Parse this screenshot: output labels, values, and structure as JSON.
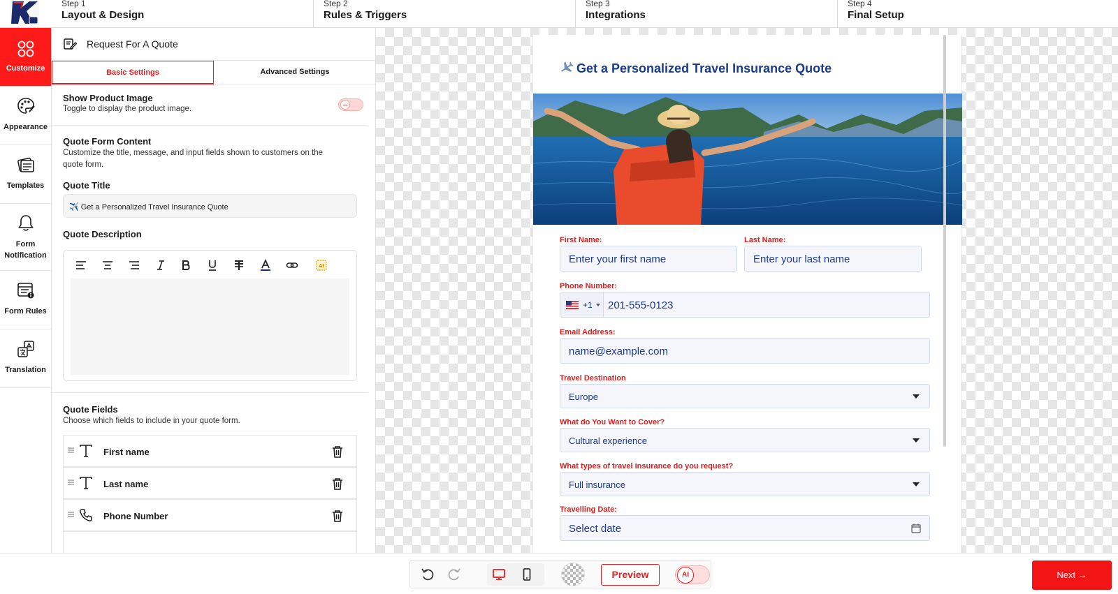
{
  "steps": [
    {
      "num": "Step 1",
      "name": "Layout & Design"
    },
    {
      "num": "Step 2",
      "name": "Rules & Triggers"
    },
    {
      "num": "Step 3",
      "name": "Integrations"
    },
    {
      "num": "Step 4",
      "name": "Final Setup"
    }
  ],
  "rail": {
    "items": [
      {
        "label": "Customize",
        "icon": "grid-icon",
        "active": true
      },
      {
        "label": "Appearance",
        "icon": "palette-icon"
      },
      {
        "label": "Templates",
        "icon": "templates-icon"
      },
      {
        "label": "Form\nNotification",
        "label_line1": "Form",
        "label_line2": "Notification",
        "icon": "bell-icon"
      },
      {
        "label": "Form Rules",
        "icon": "form-rules-icon"
      },
      {
        "label": "Translation",
        "icon": "translate-icon"
      }
    ]
  },
  "panel": {
    "title": "Request For A Quote",
    "tabs": [
      "Basic Settings",
      "Advanced Settings"
    ],
    "show_image": {
      "title": "Show Product Image",
      "desc": "Toggle to display the product image.",
      "enabled": false
    },
    "content": {
      "title": "Quote Form Content",
      "desc_line1": "Customize the title, message, and input fields shown to customers on the",
      "desc_line2": "quote form."
    },
    "quote_title": {
      "label": "Quote Title",
      "value": "✈️ Get a Personalized Travel Insurance Quote"
    },
    "quote_description": {
      "label": "Quote Description",
      "toolbar": [
        "align-left-icon",
        "align-center-icon",
        "align-right-icon",
        "italic-icon",
        "bold-icon",
        "underline-icon",
        "strikethrough-icon",
        "text-color-icon",
        "link-icon",
        "ai-icon"
      ]
    },
    "fields": {
      "title": "Quote Fields",
      "desc": "Choose which fields to include in your quote form.",
      "items": [
        {
          "label": "First name",
          "icon": "text-icon"
        },
        {
          "label": "Last name",
          "icon": "text-icon"
        },
        {
          "label": "Phone Number",
          "icon": "phone-icon"
        }
      ]
    }
  },
  "form": {
    "title": "Get a Personalized Travel Insurance Quote",
    "title_icon": "airplane-icon",
    "first_name": {
      "label": "First Name:",
      "placeholder": "Enter your first name"
    },
    "last_name": {
      "label": "Last Name:",
      "placeholder": "Enter your last name"
    },
    "phone": {
      "label": "Phone Number:",
      "country_code": "+1",
      "placeholder": "201-555-0123"
    },
    "email": {
      "label": "Email Address:",
      "placeholder": "name@example.com"
    },
    "destination": {
      "label": "Travel Destination",
      "value": "Europe"
    },
    "cover": {
      "label": "What do You Want to Cover?",
      "value": "Cultural experience"
    },
    "insurance_type": {
      "label": "What types of travel insurance do you request?",
      "value": "Full insurance"
    },
    "travel_date": {
      "label": "Travelling Date:",
      "placeholder": "Select date"
    }
  },
  "bottom": {
    "preview": "Preview",
    "ai": "AI",
    "next": "Next →"
  },
  "colors": {
    "brand_red": "#ff1a1a",
    "form_label_red": "#d91e1e",
    "form_text_blue": "#1a3a8c"
  }
}
